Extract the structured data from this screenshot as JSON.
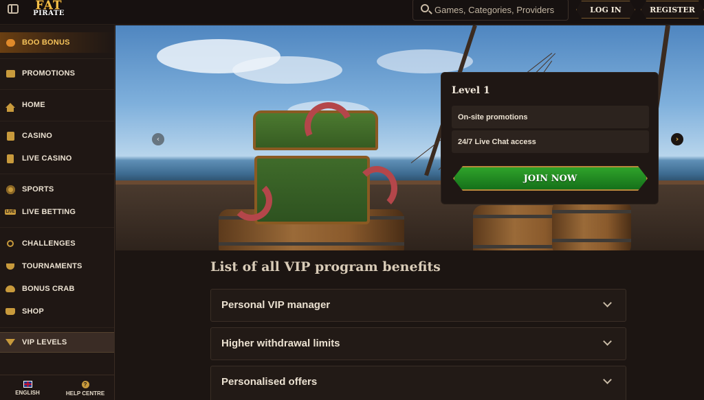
{
  "header": {
    "logo_top": "FAT",
    "logo_bottom": "PIRATE",
    "search_placeholder": "Games, Categories, Providers",
    "login_label": "LOG IN",
    "register_label": "REGISTER"
  },
  "sidebar": {
    "items": [
      {
        "label": "BOO BONUS",
        "icon": "pumpkin-icon"
      },
      {
        "label": "PROMOTIONS",
        "icon": "chest-icon"
      },
      {
        "label": "HOME",
        "icon": "home-icon"
      },
      {
        "label": "CASINO",
        "icon": "slot-icon"
      },
      {
        "label": "LIVE CASINO",
        "icon": "cards-icon"
      },
      {
        "label": "SPORTS",
        "icon": "ball-icon"
      },
      {
        "label": "LIVE BETTING",
        "icon": "live-icon"
      },
      {
        "label": "CHALLENGES",
        "icon": "medal-icon"
      },
      {
        "label": "TOURNAMENTS",
        "icon": "trophy-icon"
      },
      {
        "label": "BONUS CRAB",
        "icon": "crab-icon"
      },
      {
        "label": "SHOP",
        "icon": "basket-icon"
      },
      {
        "label": "VIP LEVELS",
        "icon": "gem-icon"
      }
    ],
    "footer": {
      "language_label": "ENGLISH",
      "help_label": "HELP CENTRE"
    }
  },
  "hero": {
    "prev_icon": "chevron-left-icon",
    "next_icon": "chevron-right-icon"
  },
  "level_card": {
    "title": "Level 1",
    "perks": [
      "On-site promotions",
      "24/7 Live Chat access"
    ],
    "cta_label": "JOIN NOW"
  },
  "benefits": {
    "title": "List of all VIP program benefits",
    "items": [
      "Personal VIP manager",
      "Higher withdrawal limits",
      "Personalised offers"
    ]
  },
  "colors": {
    "accent_gold": "#c89a3c",
    "cta_green": "#2fa32a",
    "background": "#1c1512"
  }
}
